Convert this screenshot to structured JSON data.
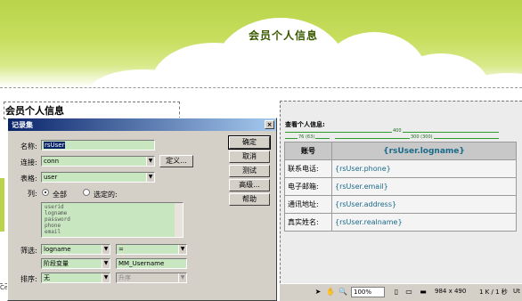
{
  "banner": {
    "title": "会员个人信息"
  },
  "page": {
    "heading": "会员个人信息",
    "left_cut": "Ce"
  },
  "dialog": {
    "title": "记录集",
    "close": "×",
    "name_label": "名称:",
    "name_value": "rsUser",
    "connection_label": "连接:",
    "connection_value": "conn",
    "define_button": "定义...",
    "table_label": "表格:",
    "table_value": "user",
    "columns_label": "列:",
    "radio_all": "全部",
    "radio_selected": "选定的:",
    "columns": [
      "userid",
      "logname",
      "password",
      "phone",
      "email"
    ],
    "filter_label": "筛选:",
    "filter_field": "logname",
    "filter_op": "=",
    "filter_source": "阶段变量",
    "filter_value": "MM_Username",
    "sort_label": "排序:",
    "sort_field": "无",
    "sort_order": "升序",
    "buttons": {
      "ok": "确定",
      "cancel": "取消",
      "test": "测试",
      "advanced": "高级...",
      "help": "帮助"
    }
  },
  "view": {
    "title": "查看个人信息:",
    "dims": {
      "total": "400",
      "left": "76 (63)",
      "right": "300 (300)"
    },
    "table": {
      "header_label": "账号",
      "header_value": "{rsUser.logname}",
      "rows": [
        {
          "label": "联系电话:",
          "value": "{rsUser.phone}"
        },
        {
          "label": "电子邮箱:",
          "value": "{rsUser.email}"
        },
        {
          "label": "通讯地址:",
          "value": "{rsUser.address}"
        },
        {
          "label": "真实姓名:",
          "value": "{rsUser.realname}"
        }
      ]
    }
  },
  "statusbar": {
    "zoom": "100%",
    "size": "984 x 490",
    "weight": "1 K / 1 秒",
    "encoding": "Ut"
  }
}
